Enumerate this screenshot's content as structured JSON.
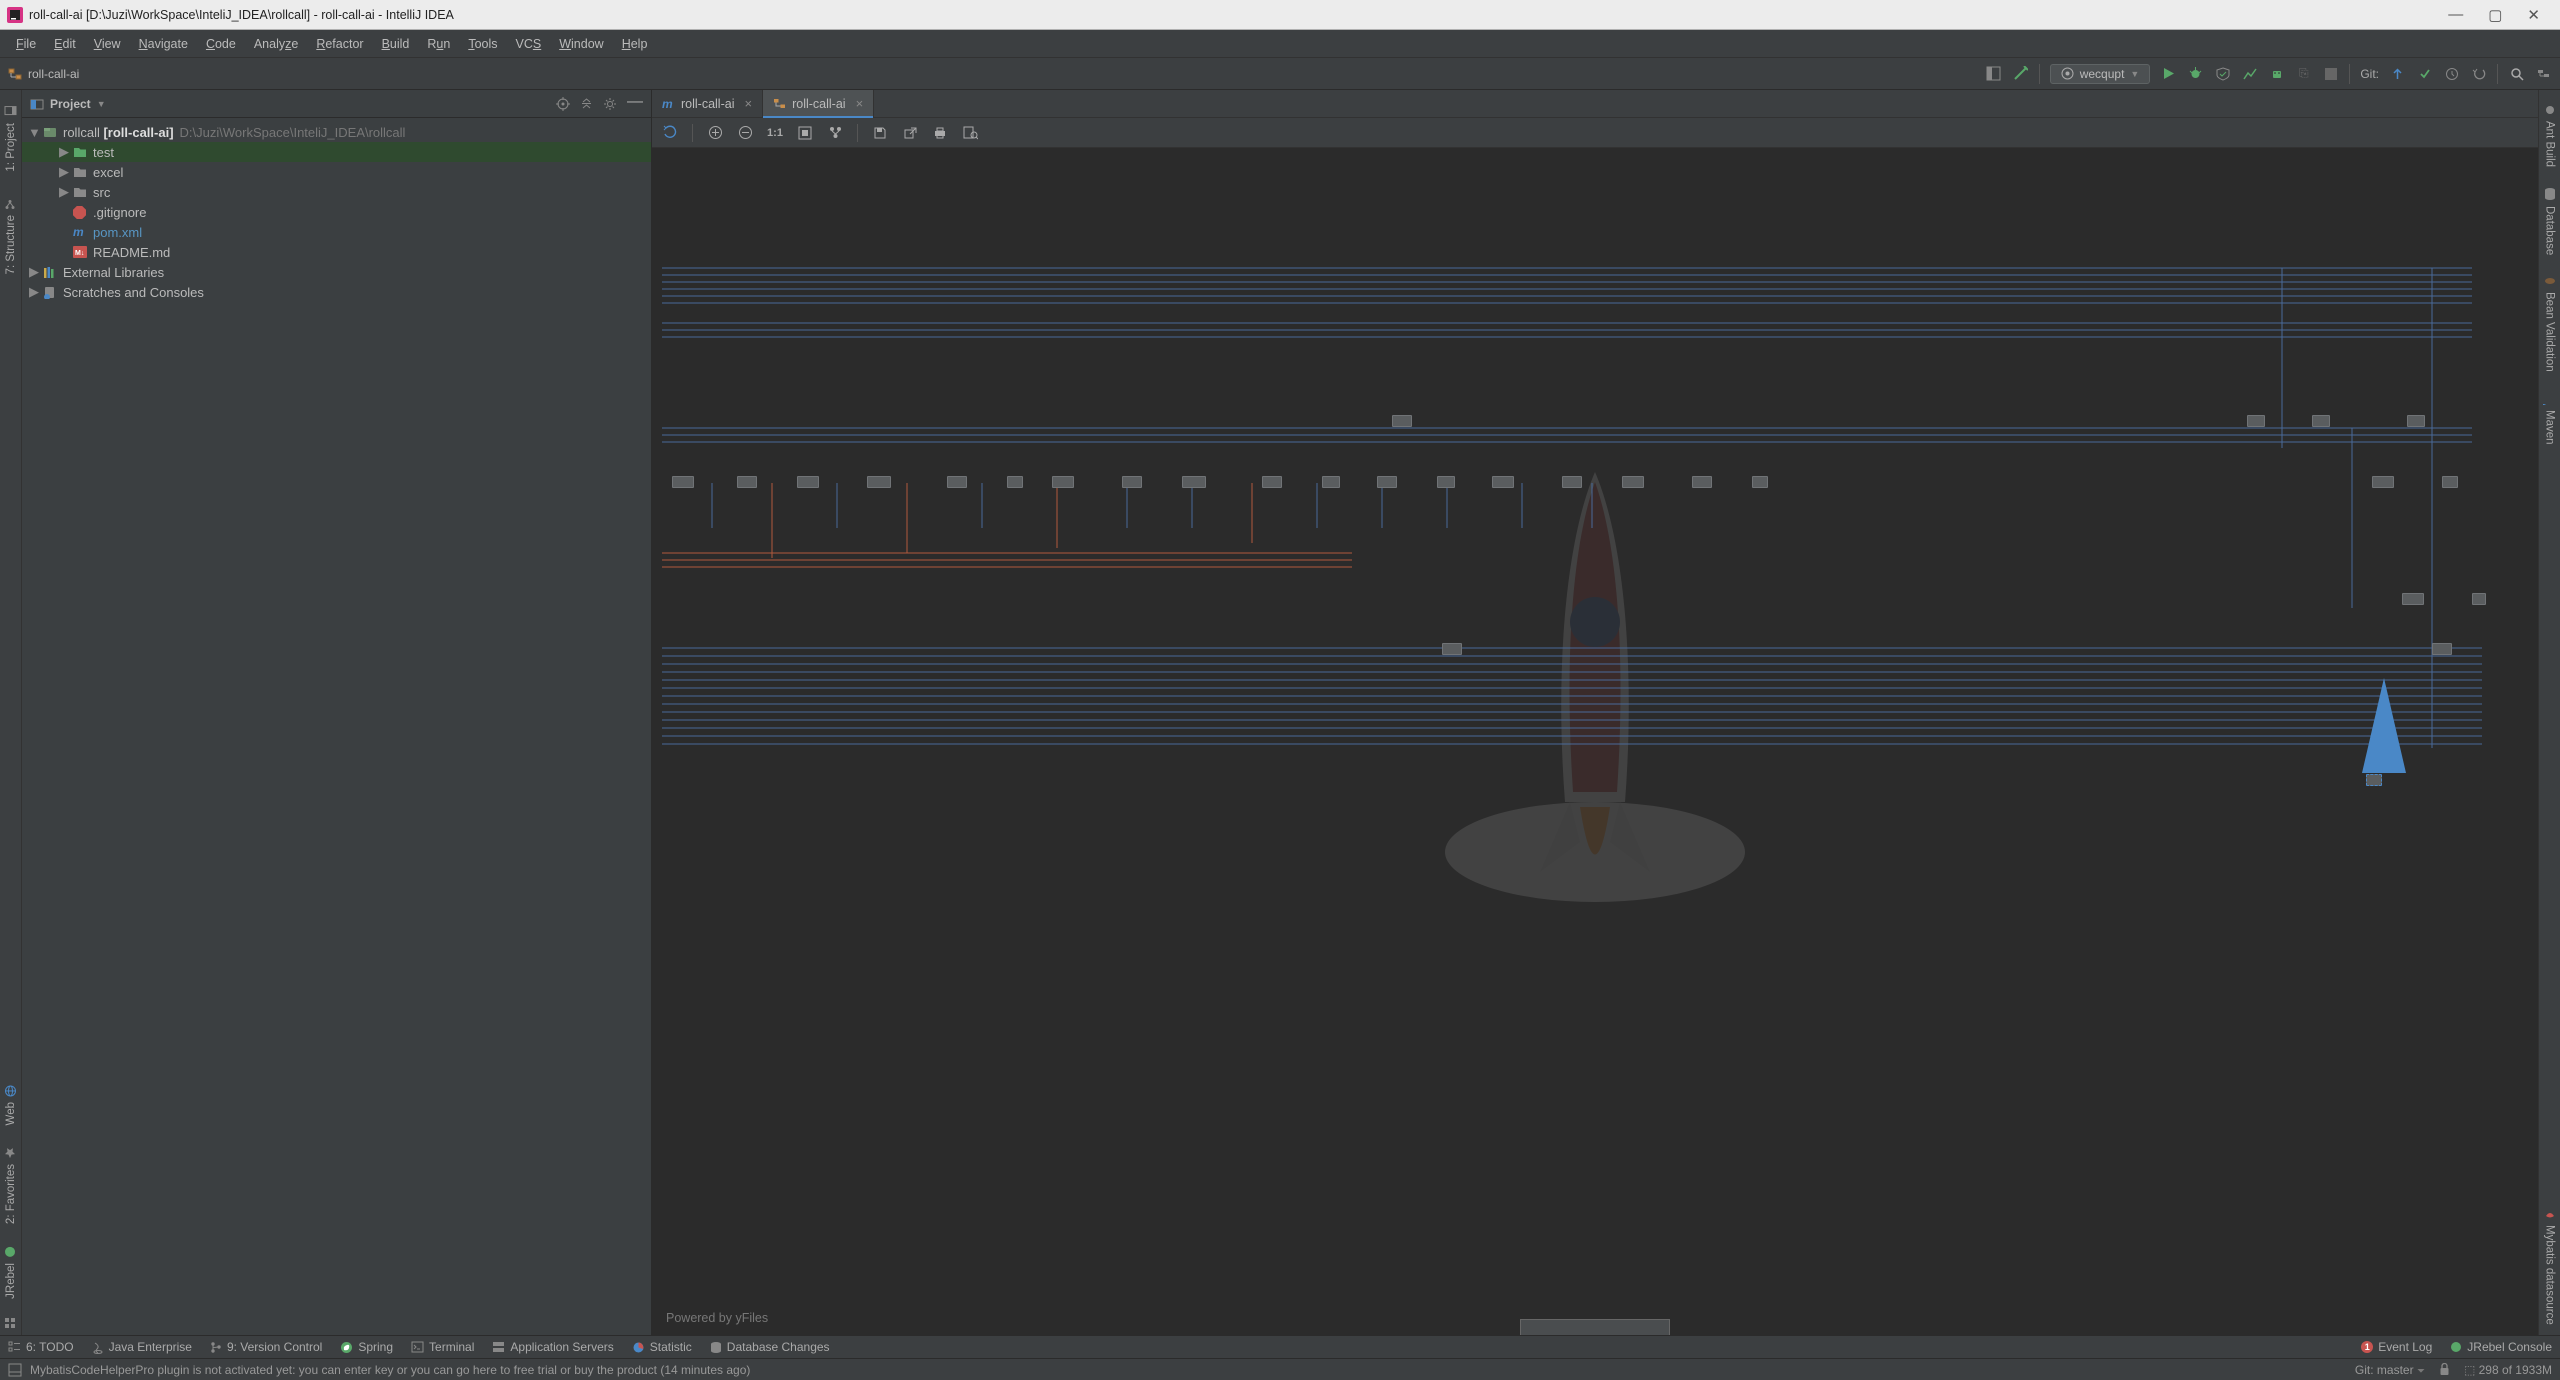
{
  "titlebar": {
    "text": "roll-call-ai [D:\\Juzi\\WorkSpace\\InteliJ_IDEA\\rollcall] - roll-call-ai - IntelliJ IDEA"
  },
  "menu": {
    "items": [
      "File",
      "Edit",
      "View",
      "Navigate",
      "Code",
      "Analyze",
      "Refactor",
      "Build",
      "Run",
      "Tools",
      "VCS",
      "Window",
      "Help"
    ]
  },
  "breadcrumb": {
    "root": "roll-call-ai"
  },
  "runconfig": {
    "name": "wecqupt"
  },
  "git_label": "Git:",
  "left_tools": {
    "project": "1: Project",
    "structure": "7: Structure",
    "web": "Web",
    "favorites": "2: Favorites",
    "jrebel": "JRebel"
  },
  "right_tools": {
    "ant": "Ant Build",
    "database": "Database",
    "bean": "Bean Validation",
    "maven": "Maven",
    "mybatis": "Mybatis datasource"
  },
  "project_panel": {
    "title": "Project",
    "root_name": "rollcall",
    "root_bold": "[roll-call-ai]",
    "root_path": "D:\\Juzi\\WorkSpace\\InteliJ_IDEA\\rollcall",
    "folders": {
      "test": "test",
      "excel": "excel",
      "src": "src"
    },
    "files": {
      "gitignore": ".gitignore",
      "pom": "pom.xml",
      "readme": "README.md"
    },
    "external": "External Libraries",
    "scratches": "Scratches and Consoles"
  },
  "editor_tabs": {
    "tab1": "roll-call-ai",
    "tab2": "roll-call-ai"
  },
  "diagram": {
    "powered": "Powered by yFiles"
  },
  "bottom_tools": {
    "todo": "6: TODO",
    "jee": "Java Enterprise",
    "vcs": "9: Version Control",
    "spring": "Spring",
    "terminal": "Terminal",
    "appservers": "Application Servers",
    "statistic": "Statistic",
    "dbchanges": "Database Changes",
    "eventlog": "Event Log",
    "jrebelconsole": "JRebel Console"
  },
  "status": {
    "message": "MybatisCodeHelperPro plugin is not activated yet: you can enter key or you can go here to free trial or buy the product (14 minutes ago)",
    "git_branch": "Git: master",
    "memory": "298 of 1933M"
  }
}
